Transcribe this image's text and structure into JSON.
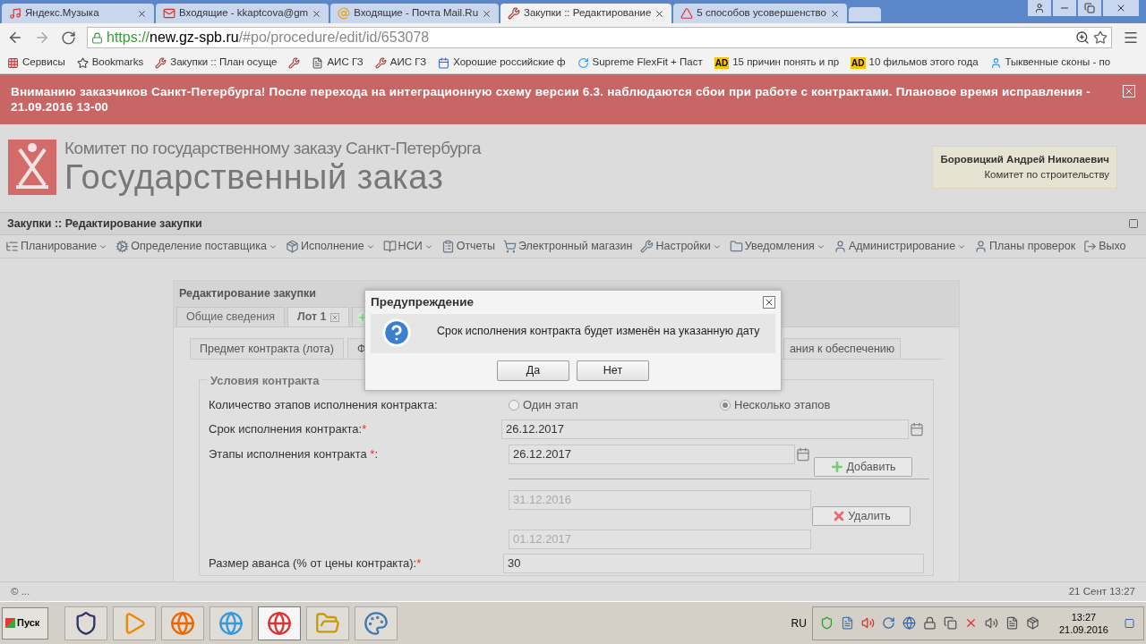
{
  "browser_tabs": [
    {
      "title": "Яндекс.Музыка",
      "selected": false
    },
    {
      "title": "Входящие - kkaptcova@gm",
      "selected": false
    },
    {
      "title": "Входящие - Почта Mail.Ru",
      "selected": false
    },
    {
      "title": "Закупки :: Редактирование",
      "selected": true
    },
    {
      "title": "5 способов усовершенство",
      "selected": false
    }
  ],
  "address": {
    "scheme": "https://",
    "host": "new.gz-spb.ru",
    "path": "/#po/procedure/edit/id/653078"
  },
  "bookmarks": [
    {
      "kind": "link",
      "label": "Сервисы"
    },
    {
      "kind": "link",
      "label": "Bookmarks"
    },
    {
      "kind": "link",
      "label": "Закупки :: План осуще"
    },
    {
      "kind": "icon"
    },
    {
      "kind": "link",
      "label": "АИС ГЗ"
    },
    {
      "kind": "link",
      "label": "АИС ГЗ"
    },
    {
      "kind": "link",
      "label": "Хорошие российские ф"
    },
    {
      "kind": "link",
      "label": "Supreme FlexFit + Паст"
    },
    {
      "kind": "link",
      "label": "15 причин понять и пр",
      "badge": "AD"
    },
    {
      "kind": "link",
      "label": "10 фильмов этого года",
      "badge": "AD"
    },
    {
      "kind": "link",
      "label": "Тыквенные сконы - по"
    }
  ],
  "banner": {
    "text": "Вниманию заказчиков Санкт-Петербурга! После перехода на интеграционную схему версии 6.3. наблюдаются сбои при работе с контрактами. Плановое время исправления - 21.09.2016 13-00"
  },
  "header": {
    "org": "Комитет по государственному заказу Санкт-Петербурга",
    "title": "Государственный заказ",
    "user": "Боровицкий Андрей Николаевич",
    "department": "Комитет по строительству"
  },
  "page_title": "Закупки :: Редактирование закупки",
  "menu": [
    {
      "label": "Планирование",
      "has_menu": true
    },
    {
      "label": "Определение поставщика",
      "has_menu": true
    },
    {
      "label": "Исполнение",
      "has_menu": true
    },
    {
      "label": "НСИ",
      "has_menu": true
    },
    {
      "label": "Отчеты",
      "has_menu": false
    },
    {
      "label": "Электронный магазин",
      "has_menu": false
    },
    {
      "label": "Настройки",
      "has_menu": true
    },
    {
      "label": "Уведомления",
      "has_menu": true
    },
    {
      "label": "Администрирование",
      "has_menu": true
    },
    {
      "label": "Планы проверок",
      "has_menu": false
    },
    {
      "label": "Выхо",
      "has_menu": false
    }
  ],
  "panel": {
    "title": "Редактирование закупки",
    "tabs": [
      {
        "label": "Общие сведения",
        "selected": false,
        "closable": false
      },
      {
        "label": "Лот 1",
        "selected": true,
        "closable": true
      }
    ],
    "sub_tabs": [
      {
        "label": "Предмет контракта (лота)"
      },
      {
        "label": "Ф"
      },
      {
        "label": "ания к обеспечению"
      }
    ],
    "fieldset": "Условия контракта",
    "stages": {
      "label": "Количество этапов исполнения контракта:",
      "options": [
        {
          "label": "Один этап",
          "selected": false
        },
        {
          "label": "Несколько этапов",
          "selected": true
        }
      ]
    },
    "deadline": {
      "label": "Срок исполнения контракта:",
      "mark": "*",
      "value": "26.12.2017"
    },
    "phases": {
      "label": "Этапы исполнения контракта ",
      "mark": "*",
      "suffix": ":",
      "value": "26.12.2017",
      "add": "Добавить",
      "remove": "Удалить",
      "dates": [
        "31.12.2016",
        "01.12.2017"
      ]
    },
    "advance": {
      "label": "Размер аванса (% от цены контракта):",
      "mark": "*",
      "value": "30"
    }
  },
  "dialog": {
    "title": "Предупреждение",
    "message": "Срок исполнения контракта будет изменён на указанную дату",
    "buttons": [
      "Да",
      "Нет"
    ]
  },
  "status_bar": {
    "left": "© ...",
    "right": "21 Сент 13:27"
  },
  "taskbar": {
    "start": "Пуск",
    "apps": [
      {
        "active": false
      },
      {
        "active": false
      },
      {
        "active": false
      },
      {
        "active": false
      },
      {
        "active": true
      },
      {
        "active": false
      },
      {
        "active": false
      }
    ],
    "lang": "RU",
    "time": "13:27",
    "date": "21.09.2016"
  }
}
